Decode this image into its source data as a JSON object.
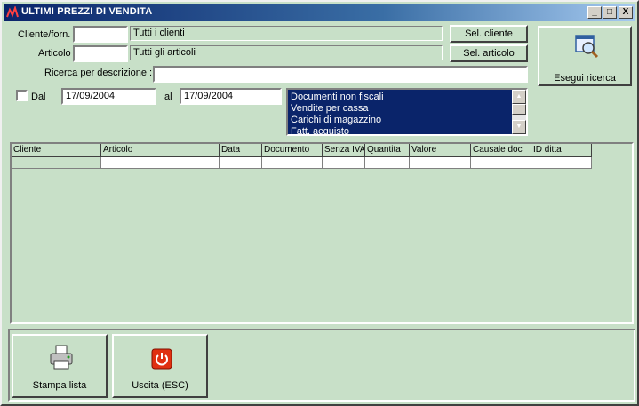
{
  "window": {
    "title": "ULTIMI PREZZI DI VENDITA",
    "controls": {
      "minimize": "_",
      "maximize": "□",
      "close": "X"
    }
  },
  "filters": {
    "cliente_label": "Cliente/forn.",
    "cliente_value": "",
    "cliente_display": "Tutti i clienti",
    "sel_cliente_button": "Sel. cliente",
    "articolo_label": "Articolo",
    "articolo_value": "",
    "articolo_display": "Tutti gli articoli",
    "sel_articolo_button": "Sel. articolo",
    "ricerca_label": "Ricerca per descrizione :",
    "ricerca_value": "",
    "dal_label": "Dal",
    "dal_checked": false,
    "dal_value": "17/09/2004",
    "al_label": "al",
    "al_value": "17/09/2004"
  },
  "doc_types": {
    "items": [
      "Documenti non fiscali",
      "Vendite per cassa",
      "Carichi di magazzino",
      "Fatt. acquisto"
    ]
  },
  "search_button": {
    "label": "Esegui ricerca",
    "icon": "magnifier-window-icon"
  },
  "grid": {
    "columns": [
      "Cliente",
      "Articolo",
      "Data",
      "Documento",
      "Senza IVA",
      "Quantita",
      "Valore",
      "Causale doc",
      "ID ditta"
    ],
    "rows": [
      [
        "",
        "",
        "",
        "",
        "",
        "",
        "",
        "",
        ""
      ]
    ]
  },
  "footer": {
    "print_button": {
      "label": "Stampa lista",
      "icon": "printer-icon"
    },
    "exit_button": {
      "label": "Uscita (ESC)",
      "icon": "power-icon"
    }
  },
  "colors": {
    "background": "#c8e0c8",
    "title_bar": "#0a246a",
    "list_selection": "#0a246a",
    "exit_icon": "#e03010"
  }
}
